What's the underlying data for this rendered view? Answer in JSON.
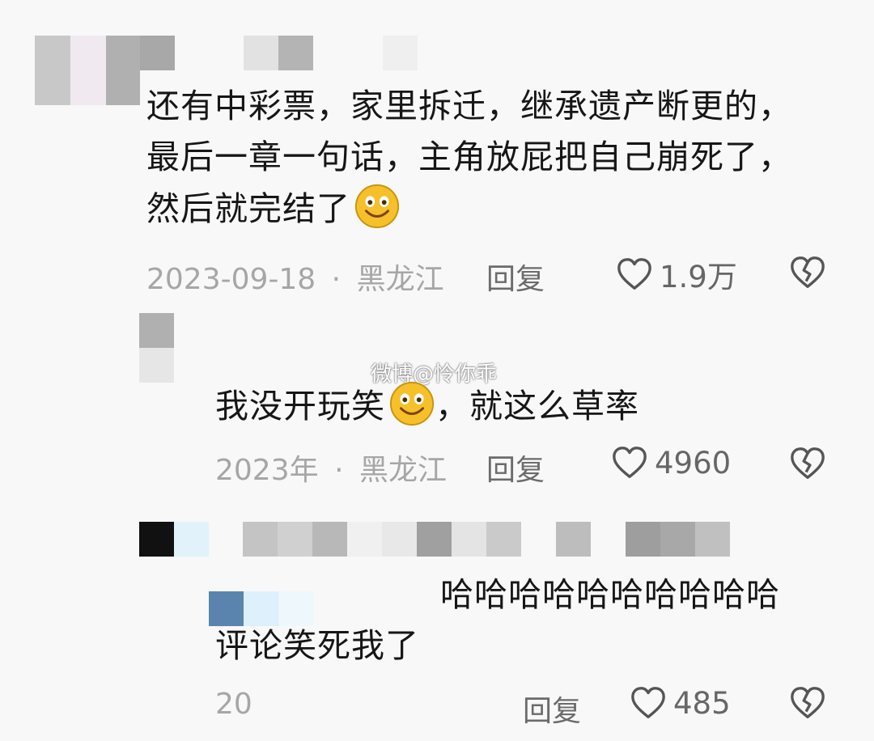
{
  "comments": [
    {
      "lines": [
        "还有中彩票，家里拆迁，继承遗产断更的，",
        "最后一章一句话，主角放屁把自己崩死了，",
        "然后就完结了"
      ],
      "emoji": "grinning-face-icon",
      "date": "2023-09-18",
      "dot": "·",
      "location": "黑龙江",
      "reply_label": "回复",
      "likes": "1.9万"
    },
    {
      "lines": [
        "我没开玩笑",
        "，就这么草率"
      ],
      "emoji": "grinning-face-icon",
      "date": "2023年",
      "dot": "·",
      "location": "黑龙江",
      "reply_label": "回复",
      "likes": "4960"
    },
    {
      "lines": [
        "哈哈哈哈哈哈哈哈哈哈",
        "评论笑死我了"
      ],
      "date": "20",
      "reply_label": "回复",
      "likes": "485"
    }
  ],
  "watermark": "微博@怜你乖",
  "colors": {
    "text": "#161616",
    "meta": "#a6a6a6",
    "reply": "#6b6b6b",
    "emoji": "#f5c02a"
  }
}
